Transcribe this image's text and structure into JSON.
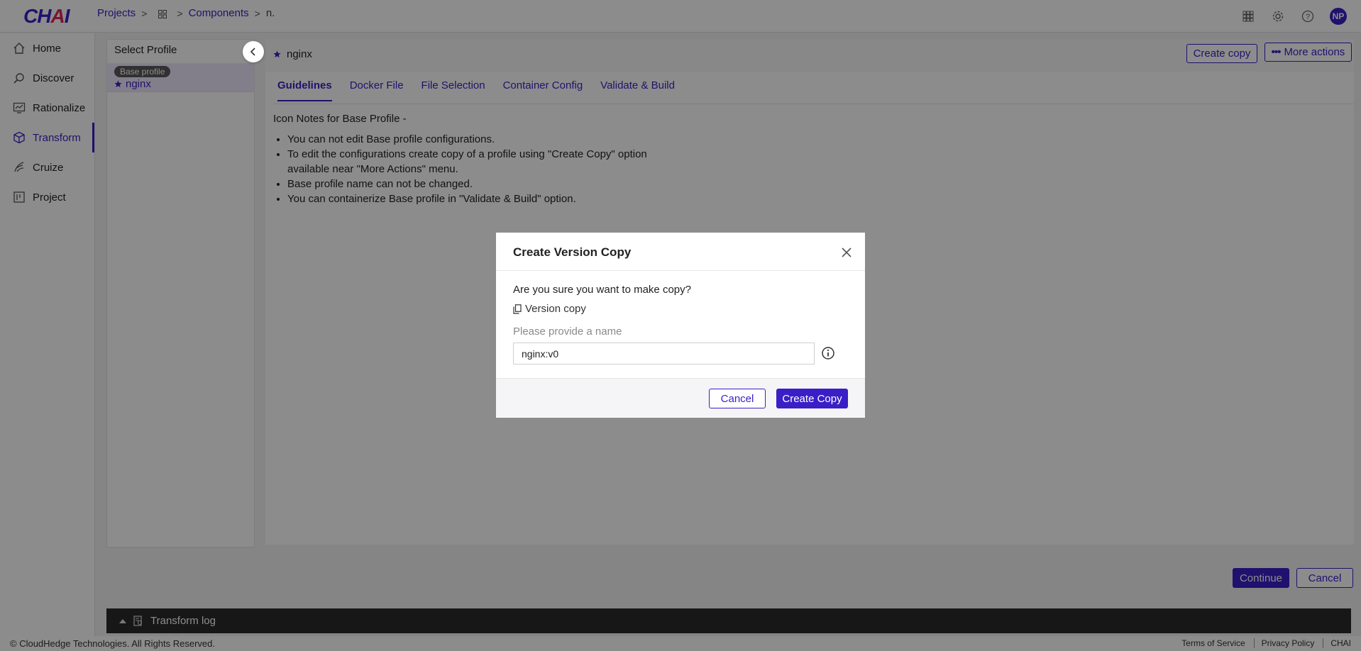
{
  "app": {
    "logo": "CHAI"
  },
  "breadcrumb": {
    "projects": "Projects",
    "components": "Components",
    "current": "n."
  },
  "nav": {
    "items": [
      {
        "label": "Home",
        "icon": "home-icon"
      },
      {
        "label": "Discover",
        "icon": "discover-icon"
      },
      {
        "label": "Rationalize",
        "icon": "rationalize-icon"
      },
      {
        "label": "Transform",
        "icon": "transform-icon",
        "active": true
      },
      {
        "label": "Cruize",
        "icon": "cruize-icon"
      },
      {
        "label": "Project",
        "icon": "project-icon"
      }
    ]
  },
  "header": {
    "avatar": "NP"
  },
  "profile_panel": {
    "title": "Select Profile",
    "badge": "Base profile",
    "profile_name": "nginx"
  },
  "main": {
    "title": "nginx",
    "create_copy": "Create copy",
    "more_actions": "More actions",
    "tabs": [
      "Guidelines",
      "Docker File",
      "File Selection",
      "Container Config",
      "Validate & Build"
    ],
    "notes_title": "Icon Notes for Base Profile -",
    "notes": [
      "You can not edit Base profile configurations.",
      "To edit the configurations create copy of a profile using \"Create Copy\" option available near \"More Actions\" menu.",
      "Base profile name can not be changed.",
      "You can containerize Base profile in \"Validate & Build\" option."
    ],
    "continue": "Continue",
    "cancel": "Cancel"
  },
  "log": {
    "label": "Transform log"
  },
  "footer": {
    "copyright": "© CloudHedge Technologies. All Rights Reserved.",
    "terms": "Terms of Service",
    "privacy": "Privacy Policy",
    "brand": "CHAI"
  },
  "modal": {
    "title": "Create Version Copy",
    "confirm": "Are you sure you want to make copy?",
    "version_label": "Version copy",
    "name_label": "Please provide a name",
    "name_value": "nginx:v0",
    "cancel": "Cancel",
    "create": "Create Copy"
  },
  "colors": {
    "accent": "#3a1fc7",
    "logo_dot": "#e0235b"
  }
}
